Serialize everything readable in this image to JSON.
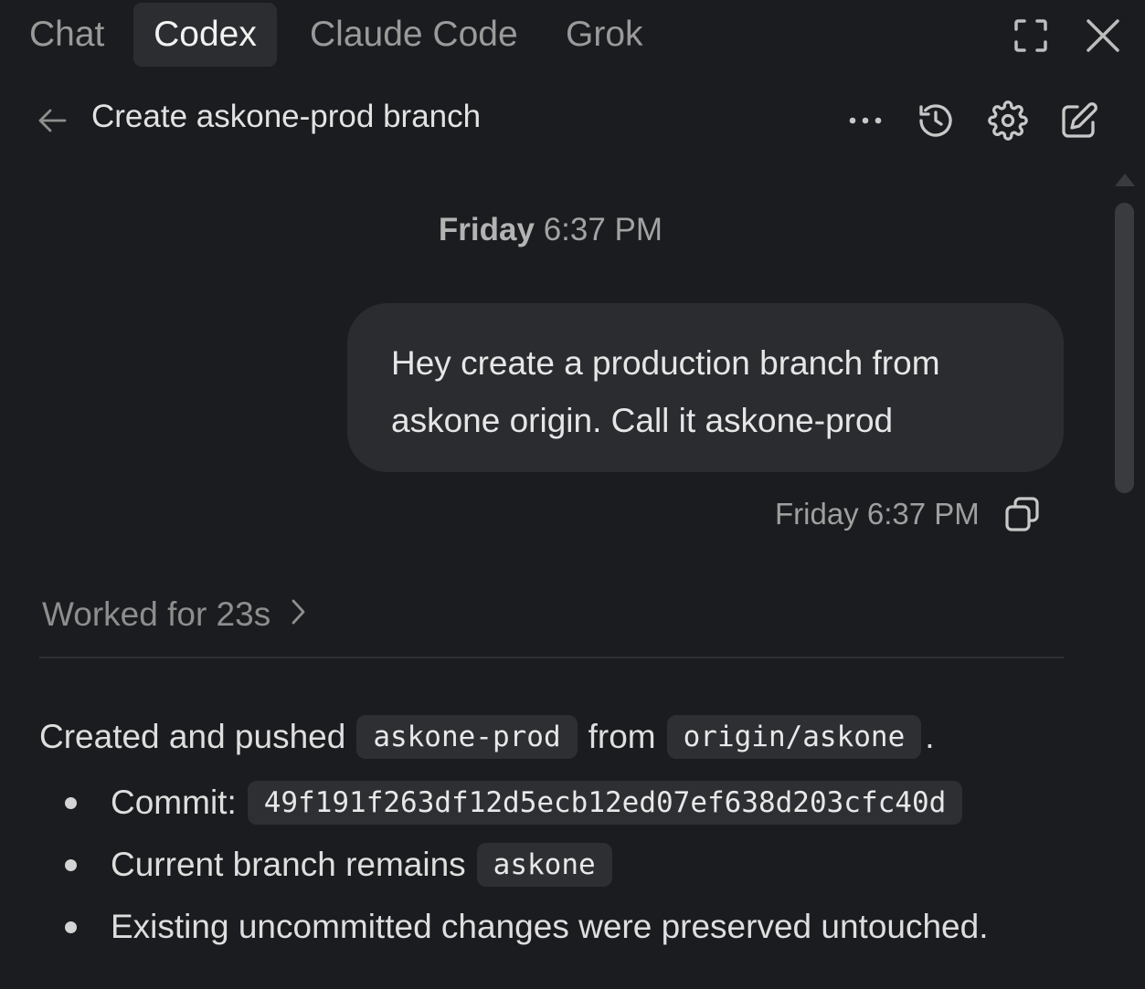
{
  "tabs": [
    {
      "label": "Chat",
      "active": false
    },
    {
      "label": "Codex",
      "active": true
    },
    {
      "label": "Claude Code",
      "active": false
    },
    {
      "label": "Grok",
      "active": false
    }
  ],
  "window_controls": {
    "fullscreen_icon": "fullscreen-icon",
    "close_icon": "close-icon"
  },
  "header": {
    "back_icon": "arrow-left-icon",
    "title": "Create askone-prod branch",
    "action_icons": [
      "more-icon",
      "history-icon",
      "gear-icon",
      "edit-icon"
    ]
  },
  "conversation": {
    "date_separator": {
      "day": "Friday",
      "time": "6:37 PM"
    },
    "user_message": {
      "text": "Hey create a production branch from askone origin. Call it askone-prod",
      "timestamp": "Friday 6:37 PM",
      "copy_icon": "copy-icon"
    },
    "worked": {
      "label": "Worked for 23s",
      "icon": "chevron-right-icon"
    },
    "response": {
      "intro_prefix": "Created and pushed",
      "intro_code_1": "askone-prod",
      "intro_middle": "from",
      "intro_code_2": "origin/askone",
      "intro_suffix": ".",
      "bullets": [
        {
          "text": "Commit:",
          "code": "49f191f263df12d5ecb12ed07ef638d203cfc40d"
        },
        {
          "text": "Current branch remains",
          "code": "askone"
        },
        {
          "text": "Existing uncommitted changes were preserved untouched.",
          "code": ""
        }
      ]
    }
  },
  "colors": {
    "background": "#1b1c1f",
    "active_tab": "#2c2d31",
    "bubble": "#2b2c30",
    "code_bg": "#2e2f33",
    "text_primary": "#e6e6e6",
    "text_muted": "#9a9a9a"
  }
}
